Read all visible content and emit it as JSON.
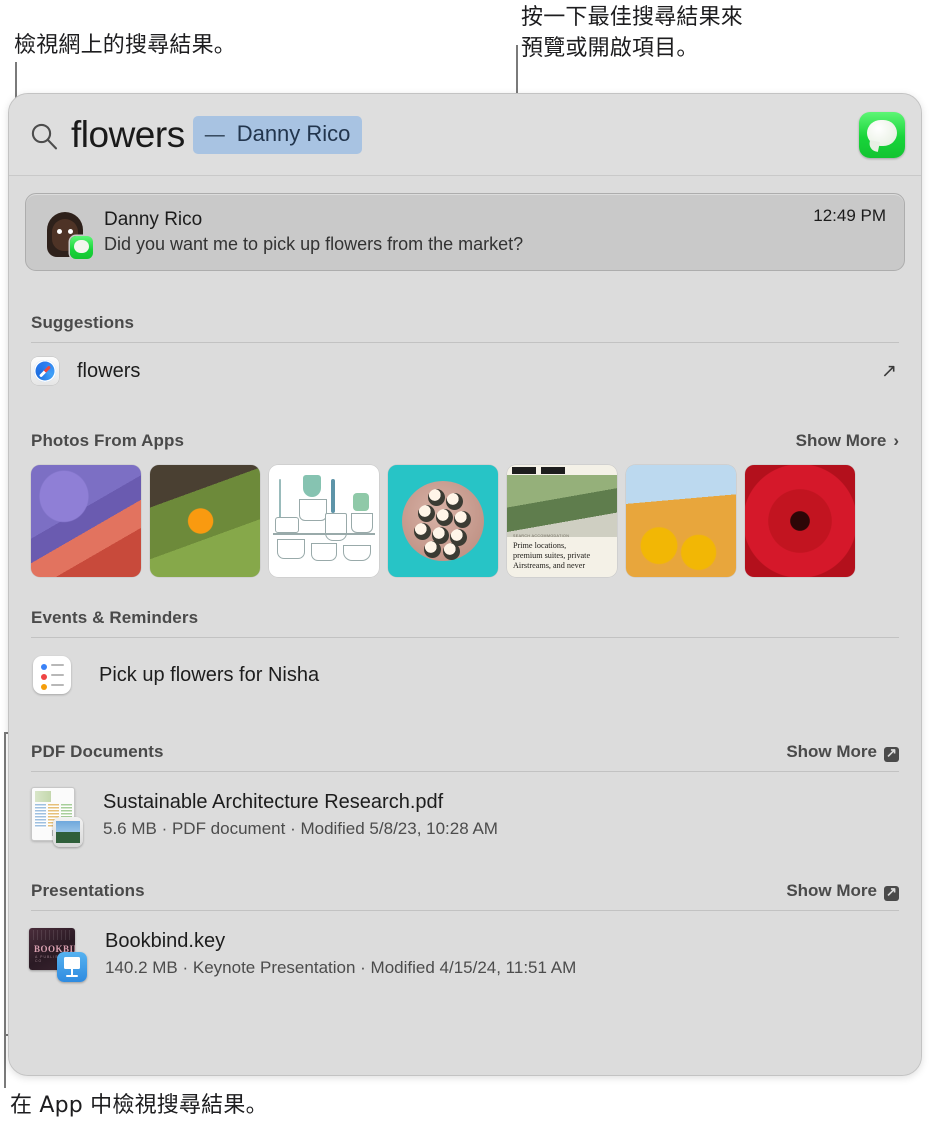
{
  "annotations": {
    "top_left": "檢視網上的搜尋結果。",
    "top_right": "按一下最佳搜尋結果來\n預覽或開啟項目。",
    "bottom_left": "在 App 中檢視搜尋結果。"
  },
  "search": {
    "icon": "search-icon",
    "query": "flowers",
    "token_dash": "—",
    "token_name": "Danny Rico",
    "app_icon": "messages-icon"
  },
  "top_hit": {
    "avatar": "memoji-avatar",
    "badge_icon": "messages-badge-icon",
    "name": "Danny Rico",
    "snippet": "Did you want me to pick up flowers from the market?",
    "time": "12:49 PM"
  },
  "sections": {
    "suggestions": {
      "title": "Suggestions",
      "item_icon": "safari-icon",
      "item_label": "flowers",
      "open_icon": "↗"
    },
    "photos": {
      "title": "Photos From Apps",
      "show_more": "Show More",
      "chevron": "›",
      "thumbnails": [
        {
          "name": "purple-iris-photo",
          "alt": "Purple iris and coral dahlia flowers"
        },
        {
          "name": "orange-marigold-photo",
          "alt": "Orange marigold in a garden"
        },
        {
          "name": "plants-illustration",
          "alt": "Line illustration of potted plants"
        },
        {
          "name": "sushi-platter-photo",
          "alt": "Sushi rolls on a plate"
        },
        {
          "name": "article-screenshot",
          "alt": "Article screenshot with caption"
        },
        {
          "name": "sunflowers-friends-photo",
          "alt": "Three friends holding sunflowers"
        },
        {
          "name": "red-dahlia-photo",
          "alt": "Close-up of a red dahlia"
        }
      ],
      "article_kicker": "SEARCH ACCOMMODATION",
      "article_caption": "Prime locations,\npremium suites, private\nAirstreams, and never"
    },
    "events": {
      "title": "Events & Reminders",
      "item_icon": "reminders-icon",
      "item_label": "Pick up flowers for Nisha"
    },
    "pdf": {
      "title": "PDF Documents",
      "show_more": "Show More",
      "item_icon": "pdf-document-icon",
      "item_title": "Sustainable Architecture Research.pdf",
      "item_sub": "5.6 MB · PDF document · Modified 5/8/23, 10:28 AM"
    },
    "presentations": {
      "title": "Presentations",
      "show_more": "Show More",
      "item_icon": "keynote-document-icon",
      "item_title": "Bookbind.key",
      "item_sub": "140.2 MB · Keynote Presentation · Modified 4/15/24, 11:51 AM",
      "slide_title": "BOOKBIND",
      "slide_sub": "A PUBLISHING CO"
    }
  },
  "colors": {
    "panel_bg": "#dcdcdc",
    "token_bg": "#a8c3e2",
    "top_hit_bg": "#c9c9c9",
    "accent_green": "#18d43a"
  }
}
